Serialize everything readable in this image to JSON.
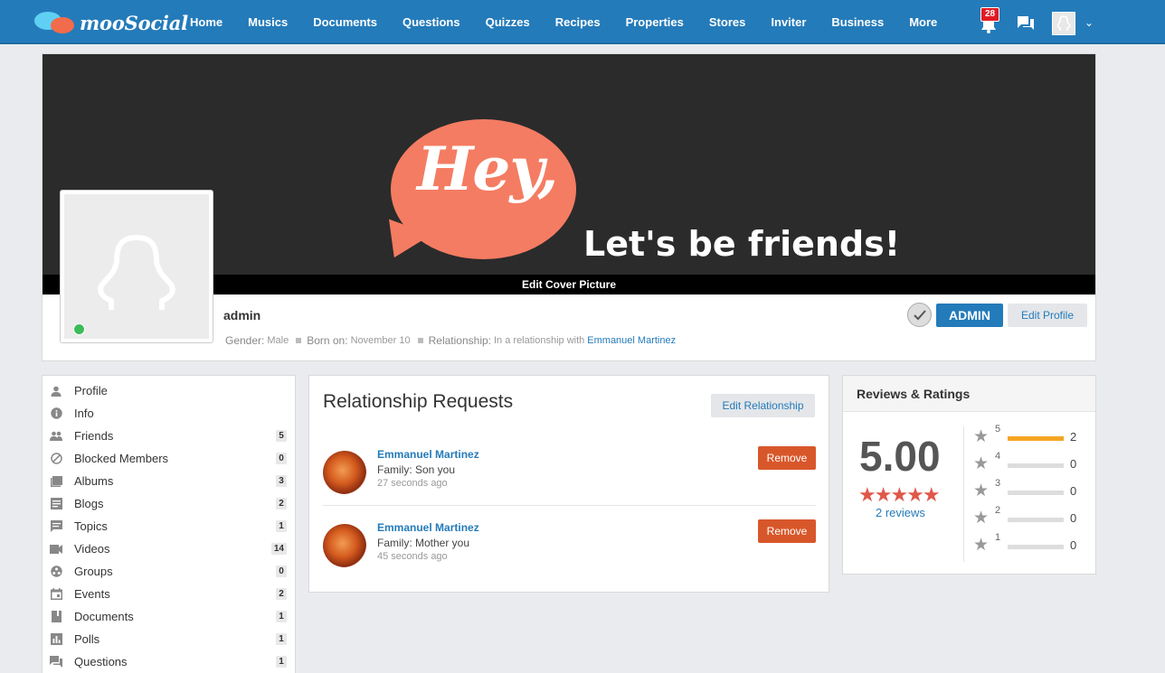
{
  "header": {
    "logo_text": "mooSocial",
    "nav": [
      "Home",
      "Musics",
      "Documents",
      "Questions",
      "Quizzes",
      "Recipes",
      "Properties",
      "Stores",
      "Inviter",
      "Business",
      "More"
    ],
    "notification_count": "28"
  },
  "cover": {
    "hey_text": "Hey,",
    "friends_text": "Let's be friends!",
    "edit_cover_label": "Edit Cover Picture"
  },
  "profile": {
    "name": "admin",
    "gender_label": "Gender:",
    "gender_value": "Male",
    "born_label": "Born on:",
    "born_value": "November 10",
    "relationship_label": "Relationship:",
    "relationship_value": "In a relationship with",
    "relationship_partner": "Emmanuel Martinez",
    "admin_label": "ADMIN",
    "edit_profile_label": "Edit Profile"
  },
  "sidebar": {
    "items": [
      {
        "label": "Profile",
        "icon": "user-icon",
        "count": ""
      },
      {
        "label": "Info",
        "icon": "info-icon",
        "count": ""
      },
      {
        "label": "Friends",
        "icon": "friends-icon",
        "count": "5"
      },
      {
        "label": "Blocked Members",
        "icon": "block-icon",
        "count": "0"
      },
      {
        "label": "Albums",
        "icon": "album-icon",
        "count": "3"
      },
      {
        "label": "Blogs",
        "icon": "blog-icon",
        "count": "2"
      },
      {
        "label": "Topics",
        "icon": "topic-icon",
        "count": "1"
      },
      {
        "label": "Videos",
        "icon": "video-icon",
        "count": "14"
      },
      {
        "label": "Groups",
        "icon": "group-icon",
        "count": "0"
      },
      {
        "label": "Events",
        "icon": "calendar-icon",
        "count": "2"
      },
      {
        "label": "Documents",
        "icon": "document-icon",
        "count": "1"
      },
      {
        "label": "Polls",
        "icon": "poll-icon",
        "count": "1"
      },
      {
        "label": "Questions",
        "icon": "question-icon",
        "count": "1"
      }
    ]
  },
  "relationship": {
    "title": "Relationship Requests",
    "edit_label": "Edit Relationship",
    "remove_label": "Remove",
    "requests": [
      {
        "name": "Emmanuel Martinez",
        "relation": "Family: Son you",
        "time": "27 seconds ago"
      },
      {
        "name": "Emmanuel Martinez",
        "relation": "Family: Mother you",
        "time": "45 seconds ago"
      }
    ]
  },
  "reviews": {
    "title": "Reviews & Ratings",
    "score": "5.00",
    "stars": "★★★★★",
    "count_label": "2 reviews",
    "breakdown": [
      {
        "stars": "5",
        "count": "2",
        "fraction": 1.0
      },
      {
        "stars": "4",
        "count": "0",
        "fraction": 0
      },
      {
        "stars": "3",
        "count": "0",
        "fraction": 0
      },
      {
        "stars": "2",
        "count": "0",
        "fraction": 0
      },
      {
        "stars": "1",
        "count": "0",
        "fraction": 0
      }
    ]
  },
  "colors": {
    "primary": "#247bba",
    "danger": "#d8572a",
    "accent_star": "#e0584a",
    "bar_fill": "#f5a623"
  }
}
